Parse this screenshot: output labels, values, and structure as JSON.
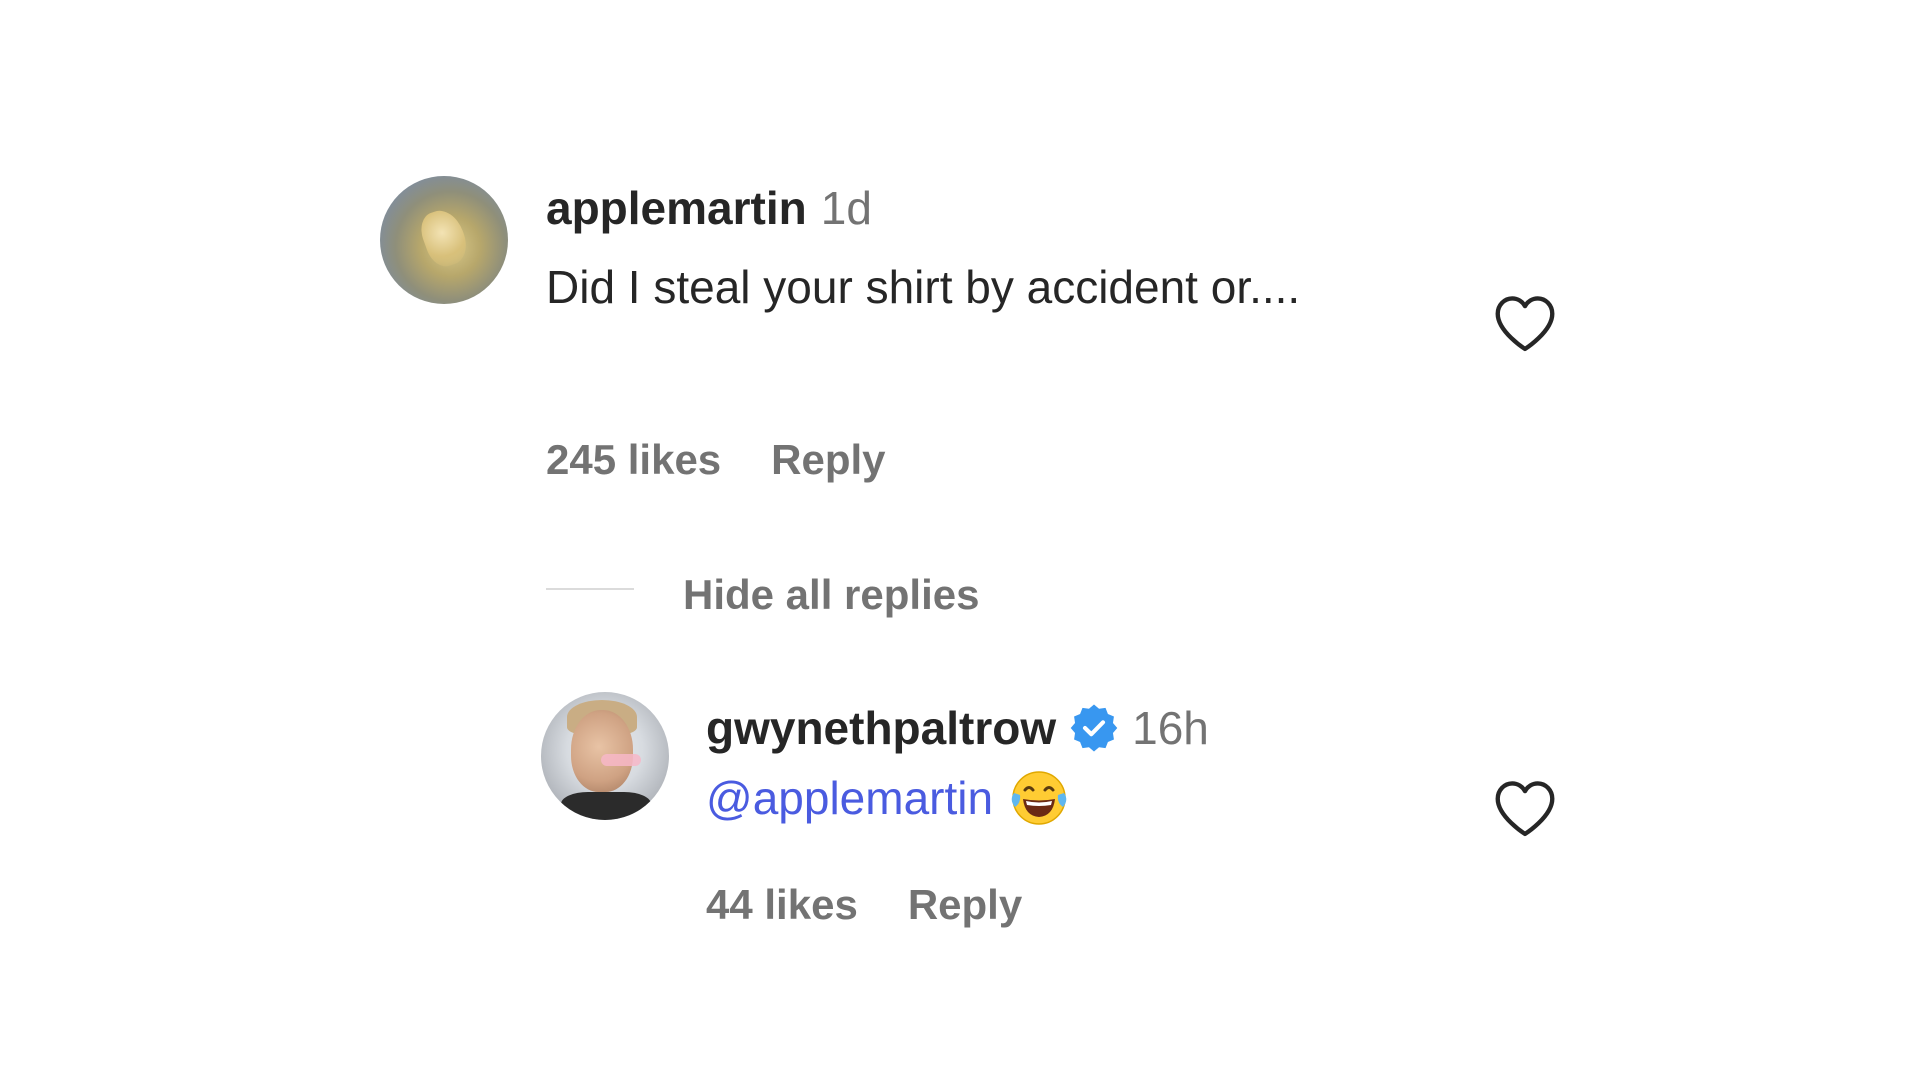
{
  "comments": [
    {
      "username": "applemartin",
      "time": "1d",
      "text": "Did I steal your shirt by accident or....",
      "likes": "245 likes",
      "reply_label": "Reply"
    }
  ],
  "hide_replies_label": "Hide all replies",
  "replies": [
    {
      "username": "gwynethpaltrow",
      "verified": true,
      "time": "16h",
      "mention": "@applemartin",
      "emoji": "face-with-tears-of-joy",
      "likes": "44 likes",
      "reply_label": "Reply"
    }
  ],
  "colors": {
    "mention": "#4a5be0",
    "verified_badge": "#3897f0",
    "secondary_text": "#737373"
  },
  "icons": {
    "like": "heart-outline-icon",
    "verified": "verified-badge-icon"
  }
}
